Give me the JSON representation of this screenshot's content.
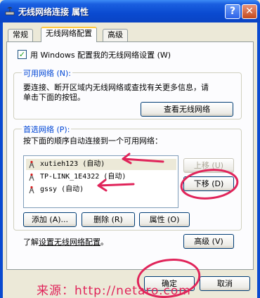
{
  "window": {
    "title": "无线网络连接 属性",
    "help_label": "?",
    "close_label": "✕"
  },
  "tabs": [
    {
      "label": "常规"
    },
    {
      "label": "无线网络配置",
      "active": true
    },
    {
      "label": "高级"
    }
  ],
  "wireless_config": {
    "use_windows_checkbox": {
      "checked": true,
      "label": "用 Windows 配置我的无线网络设置 (W)"
    },
    "available_networks": {
      "title": "可用网络 (N):",
      "description_line1": "要连接、断开区域内无线网络或查找有关更多信息，请",
      "description_line2": "单击下面的按钮。",
      "view_button": "查看无线网络"
    },
    "preferred_networks": {
      "title": "首选网络 (P):",
      "description": "按下面的顺序自动连接到一个可用网络：",
      "items": [
        {
          "name": "xutieh123 (自动)",
          "icon": "wireless-network-icon",
          "selected": true
        },
        {
          "name": "TP-LINK_1E4322 (自动)",
          "icon": "wireless-network-icon"
        },
        {
          "name": "gssy (自动)",
          "icon": "wireless-network-icon"
        }
      ],
      "move_up_button": "上移 (U)",
      "move_down_button": "下移 (D)",
      "add_button": "添加 (A)...",
      "remove_button": "删除 (R)",
      "properties_button": "属性 (O)"
    },
    "learn_more_prefix": "了解",
    "learn_more_link": "设置无线网络配置",
    "learn_more_suffix": "。",
    "advanced_button": "高级 (V)"
  },
  "footer": {
    "ok_button": "确定",
    "cancel_button": "取消"
  },
  "watermark": "来源：http://netaro.com",
  "colors": {
    "accent": "#0a4ad0",
    "annotation": "#e0245a",
    "group_title": "#0046d5"
  }
}
